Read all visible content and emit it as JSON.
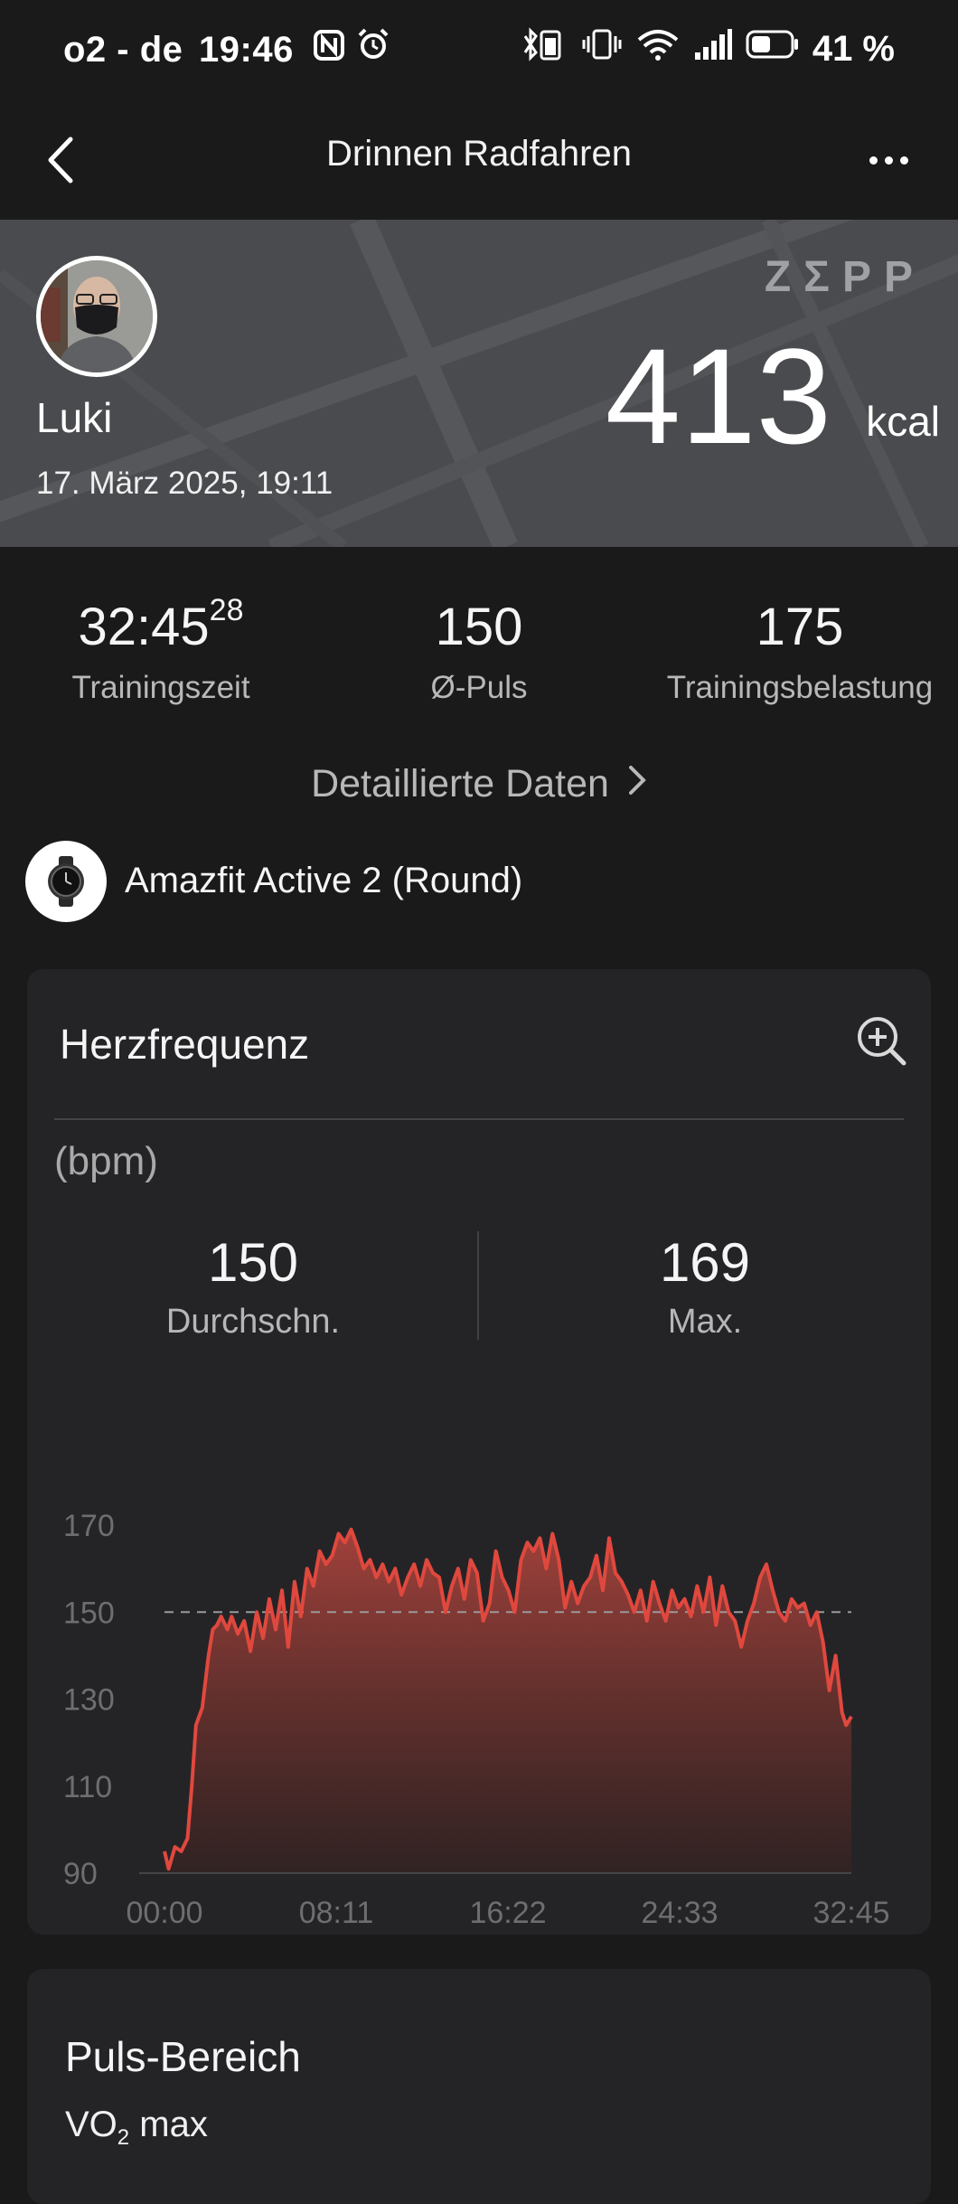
{
  "status_bar": {
    "carrier": "o2 - de",
    "time": "19:46",
    "battery": "41 %"
  },
  "header": {
    "title": "Drinnen Radfahren"
  },
  "banner": {
    "user_name": "Luki",
    "date": "17. März 2025, 19:11",
    "brand": "ZΣPP",
    "kcal_value": "413",
    "kcal_unit": "kcal"
  },
  "stats": [
    {
      "value": "32:45",
      "value_sup": "28",
      "label": "Trainingszeit"
    },
    {
      "value": "150",
      "label": "Ø-Puls"
    },
    {
      "value": "175",
      "label": "Trainingsbelastung"
    }
  ],
  "details_link": "Detaillierte Daten",
  "device": {
    "name": "Amazfit Active 2 (Round)"
  },
  "heart_rate_card": {
    "title": "Herzfrequenz",
    "unit": "(bpm)",
    "avg": {
      "value": "150",
      "label": "Durchschn."
    },
    "max": {
      "value": "169",
      "label": "Max."
    }
  },
  "chart_data": {
    "type": "area",
    "title": "",
    "xlabel": "",
    "ylabel": "(bpm)",
    "x_ticks": [
      "00:00",
      "08:11",
      "16:22",
      "24:33",
      "32:45"
    ],
    "y_ticks": [
      170,
      150,
      130,
      110,
      90
    ],
    "ylim": [
      90,
      170
    ],
    "xlim_minutes": [
      0,
      32.75
    ],
    "reference_line": 150,
    "color": "#e0483e",
    "x_minutes": [
      0,
      0.2,
      0.5,
      0.8,
      1.1,
      1.3,
      1.5,
      1.8,
      2.1,
      2.3,
      2.5,
      2.7,
      3.0,
      3.2,
      3.5,
      3.8,
      4.1,
      4.4,
      4.7,
      5.0,
      5.3,
      5.6,
      5.9,
      6.2,
      6.5,
      6.8,
      7.1,
      7.4,
      7.7,
      8.0,
      8.3,
      8.6,
      8.9,
      9.2,
      9.5,
      9.8,
      10.1,
      10.4,
      10.7,
      11.0,
      11.3,
      11.6,
      11.9,
      12.2,
      12.5,
      12.8,
      13.1,
      13.4,
      13.7,
      14.0,
      14.3,
      14.6,
      14.9,
      15.2,
      15.5,
      15.8,
      16.1,
      16.4,
      16.7,
      17.0,
      17.3,
      17.6,
      17.9,
      18.2,
      18.5,
      18.8,
      19.1,
      19.4,
      19.7,
      20.0,
      20.3,
      20.6,
      20.9,
      21.2,
      21.5,
      21.8,
      22.1,
      22.4,
      22.7,
      23.0,
      23.3,
      23.6,
      23.9,
      24.2,
      24.5,
      24.8,
      25.1,
      25.4,
      25.7,
      26.0,
      26.3,
      26.6,
      26.9,
      27.2,
      27.5,
      27.8,
      28.1,
      28.4,
      28.7,
      29.0,
      29.3,
      29.6,
      29.9,
      30.2,
      30.5,
      30.8,
      31.1,
      31.4,
      31.7,
      32.0,
      32.3,
      32.5,
      32.75
    ],
    "y_bpm": [
      95,
      91,
      96,
      95,
      98,
      110,
      124,
      128,
      140,
      146,
      147,
      149,
      146,
      149,
      145,
      148,
      141,
      150,
      144,
      153,
      146,
      155,
      142,
      157,
      149,
      160,
      156,
      164,
      161,
      163,
      168,
      166,
      169,
      165,
      160,
      162,
      158,
      161,
      157,
      160,
      154,
      158,
      161,
      156,
      162,
      159,
      158,
      150,
      156,
      160,
      153,
      162,
      159,
      148,
      152,
      164,
      158,
      155,
      150,
      162,
      166,
      164,
      167,
      160,
      168,
      162,
      151,
      157,
      152,
      156,
      158,
      163,
      155,
      167,
      159,
      157,
      154,
      150,
      155,
      148,
      157,
      152,
      148,
      155,
      151,
      153,
      149,
      156,
      150,
      158,
      147,
      156,
      150,
      148,
      142,
      148,
      152,
      158,
      161,
      155,
      150,
      148,
      153,
      151,
      152,
      147,
      150,
      143,
      132,
      140,
      127,
      124,
      126
    ]
  },
  "pulse_range_card": {
    "title": "Puls-Bereich",
    "vo2_prefix": "VO",
    "vo2_sub": "2",
    "vo2_suffix": " max"
  }
}
